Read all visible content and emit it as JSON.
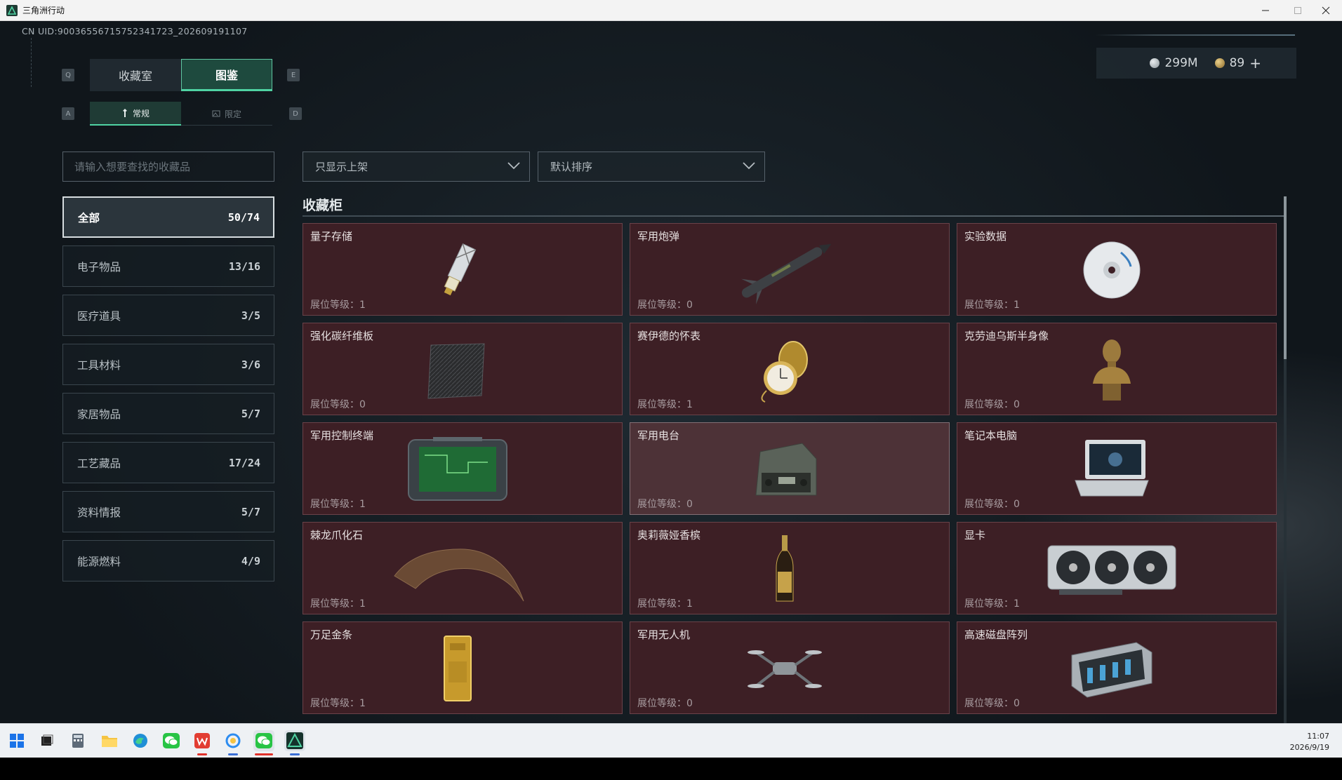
{
  "window": {
    "title": "三角洲行动"
  },
  "hud": {
    "uid": "CN UID:9003655671575234172З_202609191107",
    "currency_silver": "299M",
    "currency_gold": "89",
    "plus": "+"
  },
  "keys": {
    "q": "Q",
    "e": "E",
    "a": "A",
    "d": "D"
  },
  "tabs": [
    {
      "label": "收藏室",
      "active": false
    },
    {
      "label": "图鉴",
      "active": true
    }
  ],
  "subtabs": [
    {
      "label": "常规",
      "active": true
    },
    {
      "label": "限定",
      "active": false
    }
  ],
  "search": {
    "placeholder": "请输入想要查找的收藏品"
  },
  "categories": [
    {
      "label": "全部",
      "count": "50/74",
      "active": true
    },
    {
      "label": "电子物品",
      "count": "13/16"
    },
    {
      "label": "医疗道具",
      "count": "3/5"
    },
    {
      "label": "工具材料",
      "count": "3/6"
    },
    {
      "label": "家居物品",
      "count": "5/7"
    },
    {
      "label": "工艺藏品",
      "count": "17/24"
    },
    {
      "label": "资料情报",
      "count": "5/7"
    },
    {
      "label": "能源燃料",
      "count": "4/9"
    }
  ],
  "filters": {
    "display": "只显示上架",
    "sort": "默认排序"
  },
  "section_title": "收藏柜",
  "level_label": "展位等级：",
  "items": [
    {
      "name": "量子存储",
      "level": "1",
      "icon": "usb-drive-icon"
    },
    {
      "name": "军用炮弹",
      "level": "0",
      "icon": "missile-icon"
    },
    {
      "name": "实验数据",
      "level": "1",
      "icon": "disc-icon"
    },
    {
      "name": "强化碳纤维板",
      "level": "0",
      "icon": "carbon-plate-icon"
    },
    {
      "name": "赛伊德的怀表",
      "level": "1",
      "icon": "pocket-watch-icon"
    },
    {
      "name": "克劳迪乌斯半身像",
      "level": "0",
      "icon": "bust-icon"
    },
    {
      "name": "军用控制终端",
      "level": "1",
      "icon": "control-terminal-icon"
    },
    {
      "name": "军用电台",
      "level": "0",
      "icon": "radio-icon"
    },
    {
      "name": "笔记本电脑",
      "level": "0",
      "icon": "laptop-icon"
    },
    {
      "name": "棘龙爪化石",
      "level": "1",
      "icon": "claw-fossil-icon"
    },
    {
      "name": "奥莉薇娅香槟",
      "level": "1",
      "icon": "champagne-icon"
    },
    {
      "name": "显卡",
      "level": "1",
      "icon": "graphics-card-icon"
    },
    {
      "name": "万足金条",
      "level": "1",
      "icon": "gold-bar-icon"
    },
    {
      "name": "军用无人机",
      "level": "0",
      "icon": "drone-icon"
    },
    {
      "name": "高速磁盘阵列",
      "level": "0",
      "icon": "disk-array-icon"
    }
  ],
  "taskbar": {
    "icons": [
      "start-icon",
      "task-view-icon",
      "calculator-icon",
      "file-explorer-icon",
      "edge-icon",
      "wechat-icon",
      "wps-icon",
      "qq-browser-icon",
      "wechat-active-icon",
      "delta-force-icon"
    ],
    "time": "11:07",
    "date": "2026/9/19"
  },
  "colors": {
    "accent": "#4fd3a3",
    "card_bg": "#3d1f25",
    "card_border": "#6a4249"
  }
}
